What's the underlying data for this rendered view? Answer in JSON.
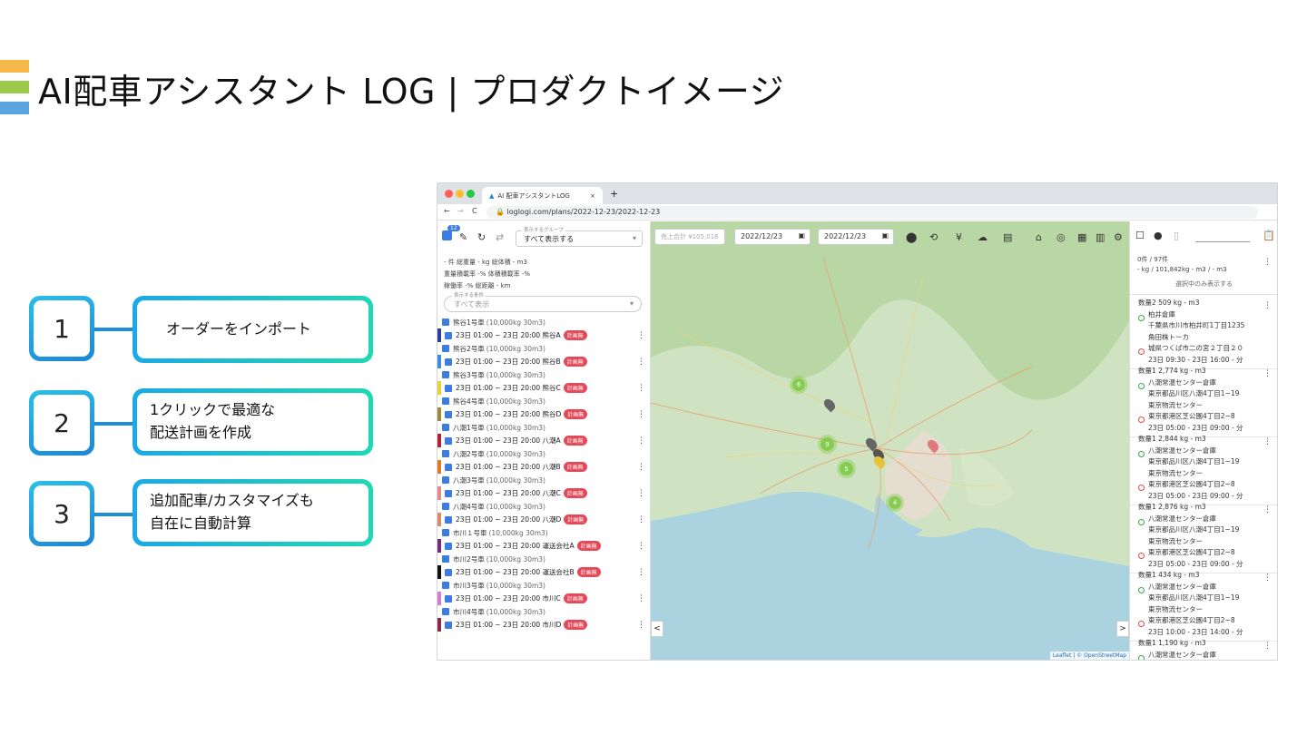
{
  "slide": {
    "title": "AI配車アシスタント LOG | プロダクトイメージ",
    "logo_colors": [
      "#f7b84b",
      "#9dc94a",
      "#5ba4e0"
    ]
  },
  "steps": [
    {
      "num": "1",
      "line1": "オーダーをインポート",
      "line2": ""
    },
    {
      "num": "2",
      "line1": "1クリックで最適な",
      "line2": "配送計画を作成"
    },
    {
      "num": "3",
      "line1": "追加配車/カスタマイズも",
      "line2": "自在に自動計算"
    }
  ],
  "browser": {
    "tab_title": "AI 配車アシスタントLOG",
    "tab_close": "×",
    "tab_add": "+",
    "url": "loglogi.com/plans/2022-12-23/2022-12-23",
    "nav": {
      "back": "←",
      "forward": "→",
      "reload": "C"
    }
  },
  "left_panel": {
    "badge_count": "12",
    "group_label": "表示するグループ",
    "group_value": "すべて表示する",
    "stats_line1": "- 件  総重量 - kg  総体積 - m3",
    "stats_line2": "重量積載率 -%  体積積載率 -%",
    "stats_line3": "稼働率 -%  総距離 - km",
    "filter_label": "表示する条件",
    "filter_value": "すべて表示",
    "vehicles": [
      {
        "name": "熊谷1号車",
        "spec": "(10,000kg 30m3)",
        "plan": "23日 01:00 ~ 23日 20:00 熊谷A",
        "badge": "計画無",
        "color": "#2c3e9e"
      },
      {
        "name": "熊谷2号車",
        "spec": "(10,000kg 30m3)",
        "plan": "23日 01:00 ~ 23日 20:00 熊谷B",
        "badge": "計画無",
        "color": "#3e8ee0"
      },
      {
        "name": "熊谷3号車",
        "spec": "(10,000kg 30m3)",
        "plan": "23日 01:00 ~ 23日 20:00 熊谷C",
        "badge": "計画無",
        "color": "#e8d43a"
      },
      {
        "name": "熊谷4号車",
        "spec": "(10,000kg 30m3)",
        "plan": "23日 01:00 ~ 23日 20:00 熊谷D",
        "badge": "計画無",
        "color": "#9a8a3a"
      },
      {
        "name": "八潮1号車",
        "spec": "(10,000kg 30m3)",
        "plan": "23日 01:00 ~ 23日 20:00 八潮A",
        "badge": "計画無",
        "color": "#b2203a"
      },
      {
        "name": "八潮2号車",
        "spec": "(10,000kg 30m3)",
        "plan": "23日 01:00 ~ 23日 20:00 八潮B",
        "badge": "計画無",
        "color": "#e07a2a"
      },
      {
        "name": "八潮3号車",
        "spec": "(10,000kg 30m3)",
        "plan": "23日 01:00 ~ 23日 20:00 八潮C",
        "badge": "計画無",
        "color": "#e38a8a"
      },
      {
        "name": "八潮4号車",
        "spec": "(10,000kg 30m3)",
        "plan": "23日 01:00 ~ 23日 20:00 八潮D",
        "badge": "計画無",
        "color": "#d98a6a"
      },
      {
        "name": "市川１号車",
        "spec": "(10,000kg 30m3)",
        "plan": "23日 01:00 ~ 23日 20:00 運送会社A",
        "badge": "計画無",
        "color": "#7a2a7a"
      },
      {
        "name": "市川2号車",
        "spec": "(10,000kg 30m3)",
        "plan": "23日 01:00 ~ 23日 20:00 運送会社B",
        "badge": "計画無",
        "color": "#111111"
      },
      {
        "name": "市川3号車",
        "spec": "(10,000kg 30m3)",
        "plan": "23日 01:00 ~ 23日 20:00 市川C",
        "badge": "計画無",
        "color": "#d77ad0"
      },
      {
        "name": "市川4号車",
        "spec": "(10,000kg 30m3)",
        "plan": "23日 01:00 ~ 23日 20:00 市川D",
        "badge": "計画無",
        "color": "#8a2a4a"
      }
    ]
  },
  "map_toolbar": {
    "sales_total": "売上合計 ¥105,016",
    "date_from": "2022/12/23",
    "date_to": "2022/12/23",
    "yen": "¥"
  },
  "map": {
    "clusters": [
      "6",
      "9",
      "5",
      "4"
    ],
    "attribution": "Leaflet | © OpenStreetMap",
    "nav_left": "<",
    "nav_right": ">"
  },
  "right_panel": {
    "summary_line1": "0件 / 97件",
    "summary_line2": "- kg / 101,842kg  - m3 / - m3",
    "selected_only": "選択中のみ表示する",
    "orders": [
      {
        "head": "数量2  509 kg  - m3",
        "from_name": "柏井倉庫",
        "from_addr": "千葉県市川市柏井町1丁目1235",
        "to_name": "角田株トーカ",
        "to_addr": "城県つくば市二の宮２丁目２０",
        "time": "23日 09:30 - 23日 16:00 - 分"
      },
      {
        "head": "数量1  2,774 kg  - m3",
        "from_name": "八潮常温センター倉庫",
        "from_addr": "東京都品川区八潮4丁目1−19",
        "to_name": "東京物流センター",
        "to_addr": "東京都港区芝公園4丁目2−8",
        "time": "23日 05:00 - 23日 09:00 - 分"
      },
      {
        "head": "数量1  2,844 kg  - m3",
        "from_name": "八潮常温センター倉庫",
        "from_addr": "東京都品川区八潮4丁目1−19",
        "to_name": "東京物流センター",
        "to_addr": "東京都港区芝公園4丁目2−8",
        "time": "23日 05:00 - 23日 09:00 - 分"
      },
      {
        "head": "数量1  2,876 kg  - m3",
        "from_name": "八潮常温センター倉庫",
        "from_addr": "東京都品川区八潮4丁目1−19",
        "to_name": "東京物流センター",
        "to_addr": "東京都港区芝公園4丁目2−8",
        "time": "23日 05:00 - 23日 09:00 - 分"
      },
      {
        "head": "数量1  434 kg  - m3",
        "from_name": "八潮常温センター倉庫",
        "from_addr": "東京都品川区八潮4丁目1−19",
        "to_name": "東京物流センター",
        "to_addr": "東京都港区芝公園4丁目2−8",
        "time": "23日 10:00 - 23日 14:00 - 分"
      },
      {
        "head": "数量1  1,190 kg  - m3",
        "from_name": "八潮常温センター倉庫",
        "from_addr": "",
        "to_name": "",
        "to_addr": "",
        "time": ""
      }
    ]
  },
  "colors": {
    "accent": "#1c86d6",
    "badge": "#e24a5a",
    "cluster": "#78c83c",
    "checkbox": "#3b7de0"
  }
}
